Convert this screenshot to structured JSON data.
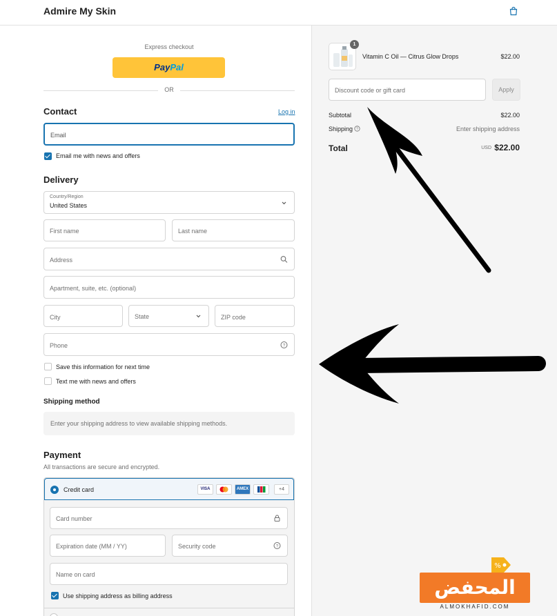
{
  "header": {
    "brand": "Admire My Skin",
    "cart_icon": "shopping-bag-icon"
  },
  "express": {
    "label": "Express checkout",
    "paypal_a": "Pay",
    "paypal_b": "Pal",
    "or": "OR"
  },
  "contact": {
    "title": "Contact",
    "login_link": "Log in",
    "email_placeholder": "Email",
    "news_label": "Email me with news and offers",
    "news_checked": true
  },
  "delivery": {
    "title": "Delivery",
    "country_label": "Country/Region",
    "country_value": "United States",
    "first_name": "First name",
    "last_name": "Last name",
    "address": "Address",
    "apartment": "Apartment, suite, etc. (optional)",
    "city": "City",
    "state": "State",
    "zip": "ZIP code",
    "phone": "Phone",
    "save_info": "Save this information for next time",
    "text_me": "Text me with news and offers"
  },
  "shipping": {
    "title": "Shipping method",
    "note": "Enter your shipping address to view available shipping methods."
  },
  "payment": {
    "title": "Payment",
    "note": "All transactions are secure and encrypted.",
    "method_label": "Credit card",
    "cards": [
      "VISA",
      "MC",
      "AMEX",
      "JCB"
    ],
    "more_cards": "+4",
    "card_number": "Card number",
    "expiry": "Expiration date (MM / YY)",
    "security": "Security code",
    "name_on_card": "Name on card",
    "billing_same": "Use shipping address as billing address",
    "billing_checked": true
  },
  "summary": {
    "product_name": "Vitamin C Oil — Citrus Glow Drops",
    "product_qty": "1",
    "product_price": "$22.00",
    "discount_placeholder": "Discount code or gift card",
    "apply_label": "Apply",
    "subtotal_label": "Subtotal",
    "subtotal_value": "$22.00",
    "shipping_label": "Shipping",
    "shipping_value": "Enter shipping address",
    "total_label": "Total",
    "total_currency": "USD",
    "total_value": "$22.00"
  },
  "watermark": {
    "arabic": "المحفض",
    "latin": "ALMOKHAFID.COM"
  },
  "colors": {
    "accent": "#1773b0",
    "paypal": "#ffc439",
    "watermark": "#f27a27"
  }
}
